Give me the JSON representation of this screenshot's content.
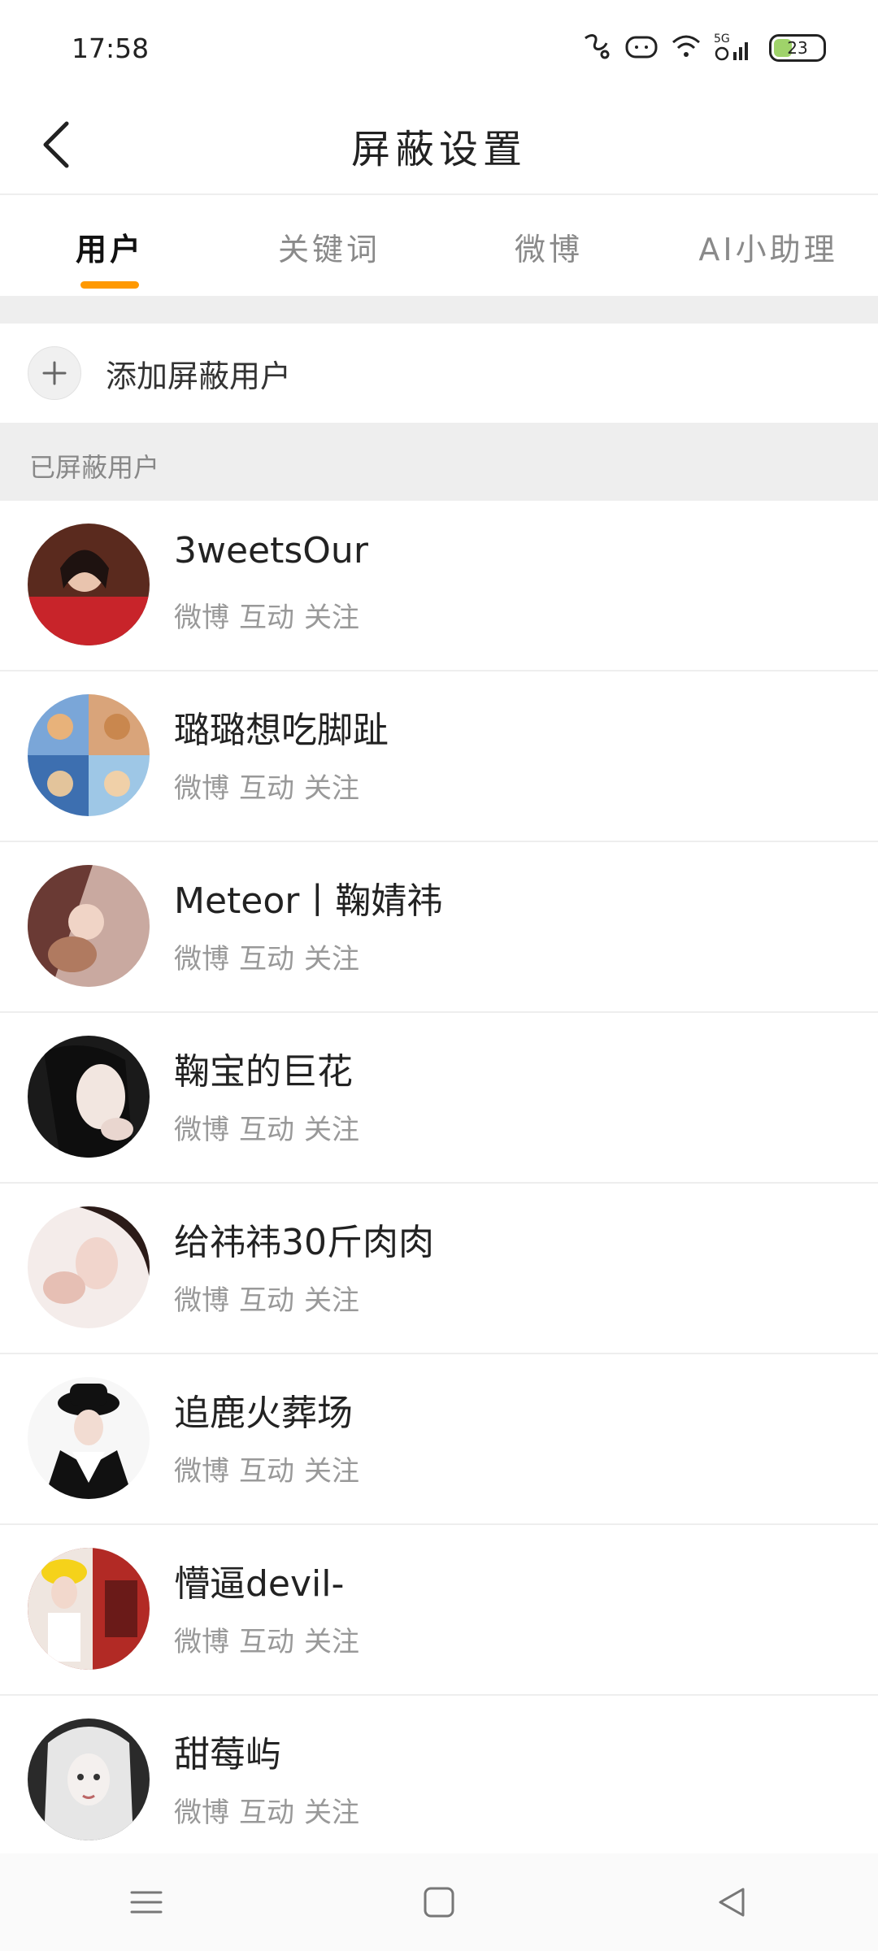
{
  "status_bar": {
    "time": "17:58",
    "network": "5G",
    "battery": "23",
    "icons": [
      "app-notification-icon",
      "cat-notification-icon",
      "wifi-icon",
      "signal-icon",
      "battery-icon"
    ]
  },
  "header": {
    "title": "屏蔽设置",
    "back_icon": "chevron-left-icon"
  },
  "tabs": [
    {
      "label": "用户",
      "active": true
    },
    {
      "label": "关键词",
      "active": false
    },
    {
      "label": "微博",
      "active": false
    },
    {
      "label": "AI小助理",
      "active": false
    }
  ],
  "add_row": {
    "icon": "plus-icon",
    "label": "添加屏蔽用户"
  },
  "section": {
    "label": "已屏蔽用户"
  },
  "users": [
    {
      "name": "3weetsOur",
      "tags": [
        "微博",
        "互动",
        "关注"
      ]
    },
    {
      "name": "璐璐想吃脚趾",
      "tags": [
        "微博",
        "互动",
        "关注"
      ]
    },
    {
      "name": "Meteor丨鞠婧祎",
      "tags": [
        "微博",
        "互动",
        "关注"
      ]
    },
    {
      "name": "鞠宝的巨花",
      "tags": [
        "微博",
        "互动",
        "关注"
      ]
    },
    {
      "name": "给祎祎30斤肉肉",
      "tags": [
        "微博",
        "互动",
        "关注"
      ]
    },
    {
      "name": "追鹿火葬场",
      "tags": [
        "微博",
        "互动",
        "关注"
      ]
    },
    {
      "name": "懵逼devil-",
      "tags": [
        "微博",
        "互动",
        "关注"
      ]
    },
    {
      "name": "甜莓屿",
      "tags": [
        "微博",
        "互动",
        "关注"
      ]
    }
  ],
  "colors": {
    "accent": "#ff9900",
    "divider": "#eeeeee",
    "muted_text": "#999999"
  },
  "nav_bar": {
    "icons": [
      "menu-icon",
      "home-square-icon",
      "back-triangle-icon"
    ]
  }
}
